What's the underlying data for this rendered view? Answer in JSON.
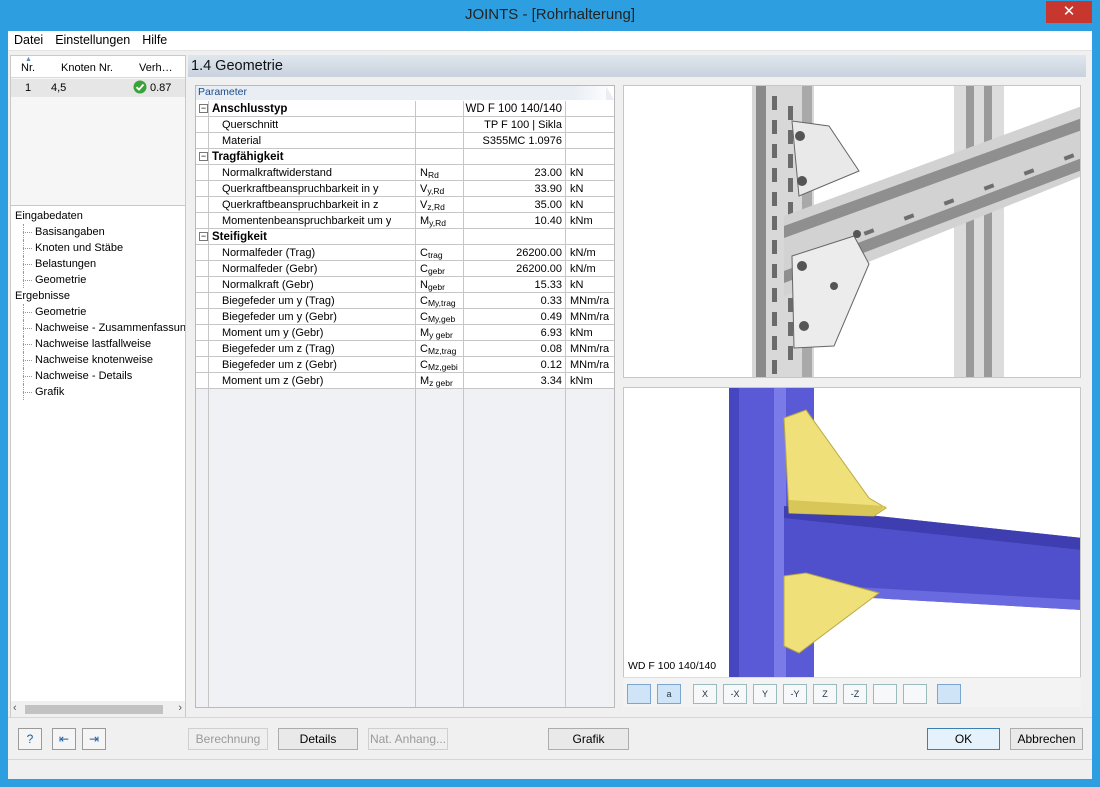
{
  "window": {
    "title": "JOINTS - [Rohrhalterung]",
    "close": "✕"
  },
  "menu": [
    "Datei",
    "Einstellungen",
    "Hilfe"
  ],
  "left_table": {
    "headers": {
      "nr": "Nr.",
      "knoten": "Knoten Nr.",
      "verh": "Verh…"
    },
    "row": {
      "nr": "1",
      "knoten": "4,5",
      "verh": "0.87"
    }
  },
  "tree": [
    {
      "label": "Eingabedaten",
      "level": 0
    },
    {
      "label": "Basisangaben",
      "level": 1
    },
    {
      "label": "Knoten und Stäbe",
      "level": 1
    },
    {
      "label": "Belastungen",
      "level": 1
    },
    {
      "label": "Geometrie",
      "level": 1
    },
    {
      "label": "Ergebnisse",
      "level": 0
    },
    {
      "label": "Geometrie",
      "level": 1
    },
    {
      "label": "Nachweise - Zusammenfassung",
      "level": 1
    },
    {
      "label": "Nachweise lastfallweise",
      "level": 1
    },
    {
      "label": "Nachweise knotenweise",
      "level": 1
    },
    {
      "label": "Nachweise - Details",
      "level": 1
    },
    {
      "label": "Grafik",
      "level": 1
    }
  ],
  "section_title": "1.4 Geometrie",
  "params_tab": "Parameter",
  "params": {
    "anschluss": {
      "label": "Anschlusstyp",
      "value": "WD F 100 140/140",
      "rows": [
        {
          "name": "Querschnitt",
          "value": "TP F 100 | Sikla"
        },
        {
          "name": "Material",
          "value": "S355MC 1.0976"
        }
      ]
    },
    "trag": {
      "label": "Tragfähigkeit",
      "rows": [
        {
          "name": "Normalkraftwiderstand",
          "sym": "N",
          "sub": "Rd",
          "value": "23.00",
          "unit": "kN"
        },
        {
          "name": "Querkraftbeanspruchbarkeit in y",
          "sym": "V",
          "sub": "y,Rd",
          "value": "33.90",
          "unit": "kN"
        },
        {
          "name": "Querkraftbeanspruchbarkeit in z",
          "sym": "V",
          "sub": "z,Rd",
          "value": "35.00",
          "unit": "kN"
        },
        {
          "name": "Momentenbeanspruchbarkeit um y",
          "sym": "M",
          "sub": "y,Rd",
          "value": "10.40",
          "unit": "kNm"
        }
      ]
    },
    "steif": {
      "label": "Steifigkeit",
      "rows": [
        {
          "name": "Normalfeder (Trag)",
          "sym": "C",
          "sub": "trag",
          "value": "26200.00",
          "unit": "kN/m"
        },
        {
          "name": "Normalfeder (Gebr)",
          "sym": "C",
          "sub": "gebr",
          "value": "26200.00",
          "unit": "kN/m"
        },
        {
          "name": "Normalkraft (Gebr)",
          "sym": "N",
          "sub": "gebr",
          "value": "15.33",
          "unit": "kN"
        },
        {
          "name": "Biegefeder um y (Trag)",
          "sym": "C",
          "sub": "My,trag",
          "value": "0.33",
          "unit": "MNm/ra"
        },
        {
          "name": "Biegefeder um y (Gebr)",
          "sym": "C",
          "sub": "My,geb",
          "value": "0.49",
          "unit": "MNm/ra"
        },
        {
          "name": "Moment um y (Gebr)",
          "sym": "M",
          "sub": "y gebr",
          "value": "6.93",
          "unit": "kNm"
        },
        {
          "name": "Biegefeder um z (Trag)",
          "sym": "C",
          "sub": "Mz,trag",
          "value": "0.08",
          "unit": "MNm/ra"
        },
        {
          "name": "Biegefeder um z (Gebr)",
          "sym": "C",
          "sub": "Mz,gebi",
          "value": "0.12",
          "unit": "MNm/ra"
        },
        {
          "name": "Moment um z (Gebr)",
          "sym": "M",
          "sub": "z gebr",
          "value": "3.34",
          "unit": "kNm"
        }
      ]
    }
  },
  "graphic_caption": "WD F 100 140/140",
  "toolbar_icons": [
    "render-mode-icon",
    "label-icon",
    "view-x-icon",
    "view-minus-x-icon",
    "view-y-icon",
    "view-minus-y-icon",
    "view-z-icon",
    "view-minus-z-icon",
    "iso-view-icon",
    "zoom-reset-icon",
    "copy-icon"
  ],
  "toolbar_labels": [
    "",
    "a",
    "X",
    "-X",
    "Y",
    "-Y",
    "Z",
    "-Z",
    "",
    "",
    ""
  ],
  "buttons": {
    "berechnung": "Berechnung",
    "details": "Details",
    "anhang": "Nat. Anhang...",
    "grafik": "Grafik",
    "ok": "OK",
    "abbrechen": "Abbrechen"
  },
  "colors": {
    "titlebar": "#2d9fe0",
    "close": "#c7372f",
    "steel": "#5a5ad6",
    "plate": "#f1e27a"
  }
}
